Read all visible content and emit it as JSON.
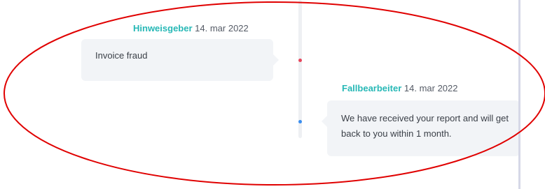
{
  "messages": [
    {
      "sender": "Hinweisgeber",
      "date": "14. mar 2022",
      "text": "Invoice fraud",
      "dot_color": "#e8465b"
    },
    {
      "sender": "Fallbearbeiter",
      "date": "14. mar 2022",
      "text": "We have received your report and will get back to you within 1 month.",
      "dot_color": "#3b8ef0"
    }
  ],
  "colors": {
    "sender": "#27b8b6",
    "bubble_bg": "#f2f4f7",
    "annotation_ellipse": "#e00000"
  }
}
